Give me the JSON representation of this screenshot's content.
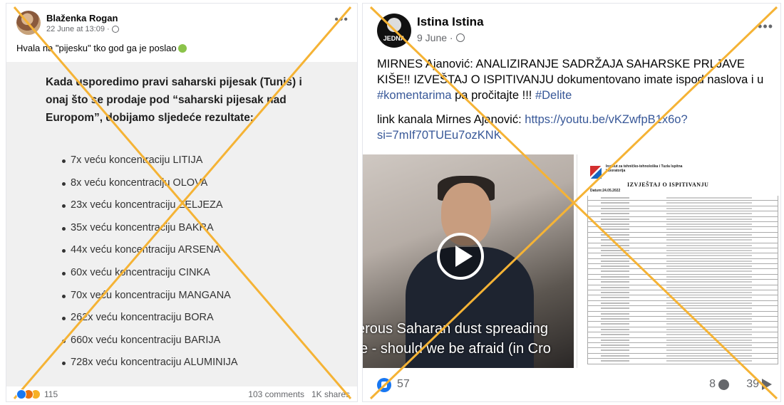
{
  "left_post": {
    "author": "Blaženka Rogan",
    "timestamp": "22 June at 13:09 ·",
    "text": "Hvala na \"pijesku\" tko god ga je poslao",
    "image_heading": "Kada usporedimo pravi saharski pijesak (Tunis) i onaj što se prodaje pod “saharski pijesak nad Europom”, dobijamo sljedeće rezultate:",
    "items": [
      "7x veću koncentraciju LITIJA",
      "8x veću koncentraciju OLOVA",
      "23x veću koncentraciju ZELJEZA",
      "35x veću koncentraciju BAKRA",
      "44x veću koncentraciju ARSENA",
      "60x veću koncentraciju CINKA",
      "70x veću koncentraciju MANGANA",
      "262x veću koncentraciju BORA",
      "660x veću koncentraciju BARIJA",
      "728x veću koncentraciju ALUMINIJA"
    ],
    "reactions_count": "115",
    "comments": "103 comments",
    "shares": "1K shares"
  },
  "right_post": {
    "author": "Istina Istina",
    "avatar_text": "JEDNA",
    "timestamp": "9 June ·",
    "text_main": "MIRNES Ajanović: ANALIZIRANJE SADRŽAJA SAHARSKE PRLJAVE KIŠE!! IZVEŠTAJ O ISPITIVANJU dokumentovano imate ispod naslova i u ",
    "hashtag_1": "#komentarima",
    "text_after_hashtag": " pa pročitajte  !!!  ",
    "hashtag_2": "#Delite",
    "link_label": "link kanala Mirnes Ajanović: ",
    "link_url": "https://youtu.be/vKZwfpB1x6o?si=7mIf70TUEu7ozKNK",
    "video_subtitle_1": "erous Saharan dust spreading",
    "video_subtitle_2": "e - should we be afraid (in Cro",
    "doc_institute": "Institut za tehničko-tehnološka i Tuzla Ispitna laboratorija",
    "doc_title": "IZVJEŠTAJ O ISPITIVANJU",
    "doc_date": "Datum:24.05.2022",
    "likes": "57",
    "comments": "8",
    "shares": "39"
  }
}
